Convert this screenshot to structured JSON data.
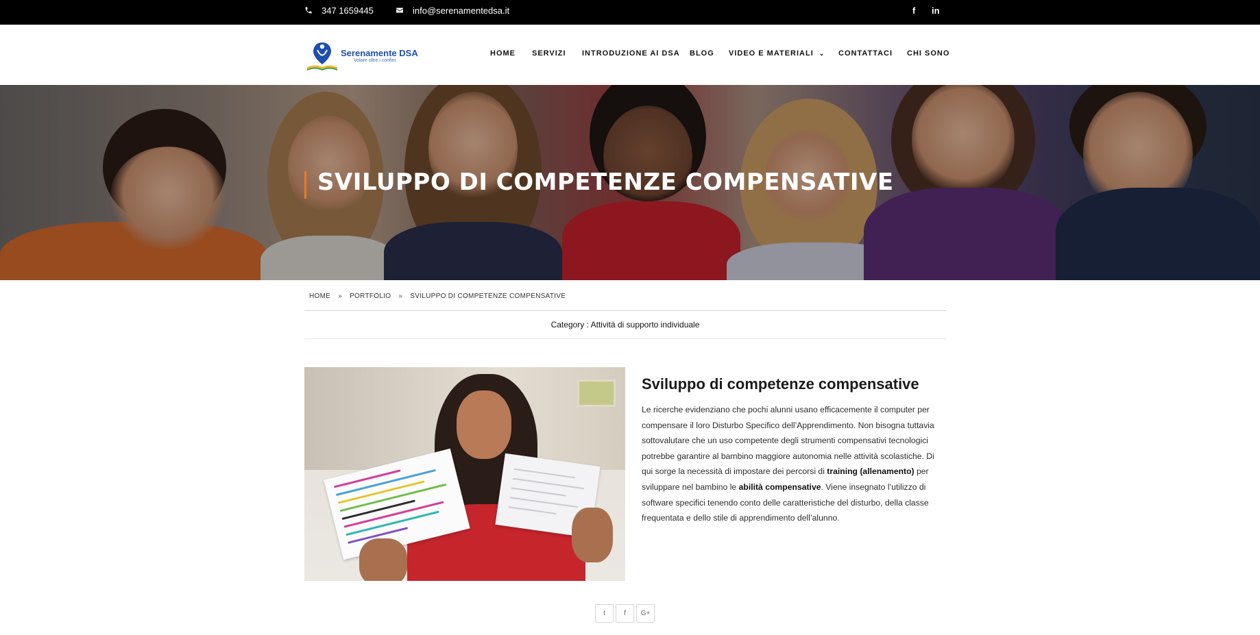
{
  "topbar": {
    "phone": "347 1659445",
    "email": "info@serenamentedsa.it",
    "phone_icon": "phone-icon",
    "email_icon": "envelope-icon",
    "social": [
      {
        "name": "facebook-icon",
        "glyph": "f"
      },
      {
        "name": "linkedin-icon",
        "glyph": "in"
      }
    ]
  },
  "header": {
    "logo_title": "Serenamente DSA",
    "logo_tagline": "Volare oltre i confini",
    "nav": [
      {
        "label": "HOME"
      },
      {
        "label": "SERVIZI"
      },
      {
        "label": "INTRODUZIONE AI DSA"
      },
      {
        "label": "BLOG"
      },
      {
        "label": "VIDEO E MATERIALI",
        "dropdown": true
      },
      {
        "label": "CONTATTACI"
      },
      {
        "label": "CHI SONO"
      }
    ],
    "chevron_icon": "chevron-down-icon"
  },
  "hero": {
    "title": "SVILUPPO DI COMPETENZE COMPENSATIVE"
  },
  "breadcrumb": {
    "items": [
      "HOME",
      "PORTFOLIO",
      "SVILUPPO DI COMPETENZE COMPENSATIVE"
    ],
    "separator": "»"
  },
  "category": {
    "label": "Category :",
    "value": "Attività di supporto individuale"
  },
  "article": {
    "title": "Sviluppo di competenze compensative",
    "body_1": "Le ricerche evidenziano che pochi alunni usano efficacemente il computer per compensare il loro Disturbo Specifico dell’Apprendimento. Non bisogna tuttavia sottovalutare che un uso competente degli strumenti compensativi tecnologici potrebbe garantire al bambino maggiore autonomia nelle attività scolastiche. Di qui sorge la necessità di impostare dei percorsi di ",
    "bold_1": "training (allenamento)",
    "body_2": " per sviluppare nel bambino le ",
    "bold_2": "abilità compensative",
    "body_3": ". Viene insegnato l’utilizzo di software specifici tenendo conto delle caratteristiche del disturbo, della classe frequentata e dello stile di apprendimento dell’alunno."
  },
  "share": {
    "twitter": "twitter-icon",
    "facebook": "facebook-icon",
    "googleplus": "google-plus-icon",
    "twitter_glyph": "t",
    "facebook_glyph": "f",
    "googleplus_glyph": "G+"
  },
  "colors": {
    "topbar_bg": "#000000",
    "accent": "#e87b2a",
    "logo_blue": "#1f4eb2"
  }
}
